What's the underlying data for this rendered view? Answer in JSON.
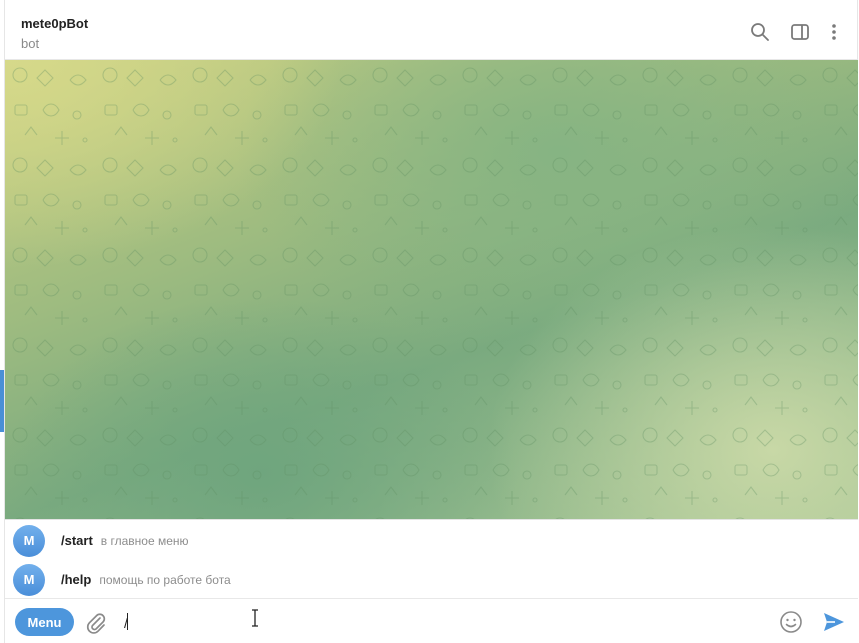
{
  "header": {
    "title": "mete0pBot",
    "subtitle": "bot"
  },
  "commands": [
    {
      "avatar_letter": "M",
      "name": "/start",
      "description": "в главное меню"
    },
    {
      "avatar_letter": "M",
      "name": "/help",
      "description": "помощь по работе бота"
    }
  ],
  "composer": {
    "menu_label": "Menu",
    "input_value": "/"
  },
  "icons": {
    "search": "search-icon",
    "sidebar": "sidebar-toggle-icon",
    "more": "more-vertical-icon",
    "attach": "paperclip-icon",
    "emoji": "smiley-icon",
    "send": "send-icon"
  },
  "colors": {
    "accent": "#4d96dc",
    "avatar": "#5a9ee2"
  }
}
